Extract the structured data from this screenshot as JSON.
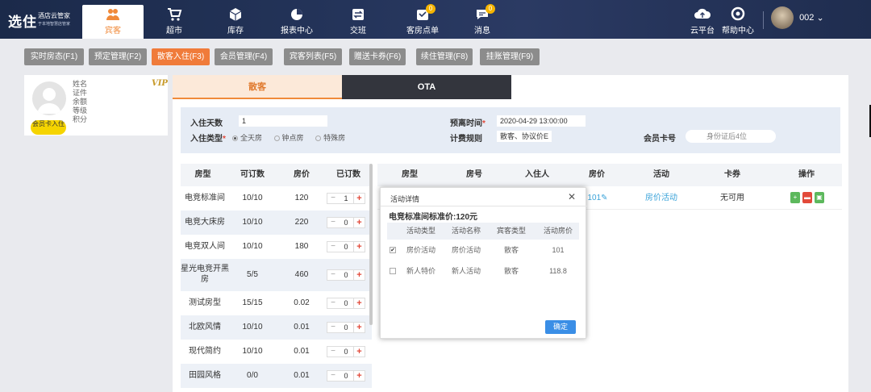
{
  "brand": {
    "logo": "选住",
    "sub1": "酒店云管家",
    "sub2": "于本地智慧店管家"
  },
  "nav": [
    {
      "label": "宾客",
      "icon": "guest-icon"
    },
    {
      "label": "超市",
      "icon": "cart-icon"
    },
    {
      "label": "库存",
      "icon": "box-icon"
    },
    {
      "label": "报表中心",
      "icon": "pie-chart-icon"
    },
    {
      "label": "交班",
      "icon": "swap-icon"
    },
    {
      "label": "客房点单",
      "icon": "order-icon",
      "badge": "0"
    },
    {
      "label": "消息",
      "icon": "message-icon",
      "badge": "0"
    }
  ],
  "right_nav": [
    {
      "label": "云平台",
      "icon": "cloud-icon"
    },
    {
      "label": "帮助中心",
      "icon": "help-icon"
    }
  ],
  "user": {
    "name": "002"
  },
  "tabs": [
    "实时房态(F1)",
    "预定管理(F2)",
    "散客入住(F3)",
    "会员管理(F4)",
    "宾客列表(F5)",
    "赠送卡券(F6)",
    "续住管理(F8)",
    "挂账管理(F9)"
  ],
  "active_tab": "散客入住(F3)",
  "member": {
    "vip": "VIP",
    "fields": [
      "姓名",
      "证件",
      "余额",
      "等级",
      "积分"
    ],
    "badge": "会员卡入住"
  },
  "segments": [
    "散客",
    "OTA"
  ],
  "filter": {
    "days_label": "入住天数",
    "days_value": "1",
    "type_label": "入住类型",
    "types": [
      "全天房",
      "钟点房",
      "特殊房"
    ],
    "leave_label": "预离时间",
    "leave_value": "2020-04-29 13:00:00",
    "rule_label": "计费规则",
    "rule_value": "散客、协议价E",
    "card_label": "会员卡号",
    "card_placeholder": "身份证后4位"
  },
  "room_table": {
    "headers": [
      "房型",
      "可订数",
      "房价",
      "已订数"
    ],
    "rows": [
      {
        "name": "电竞标准间",
        "avail": "10/10",
        "price": "120",
        "booked": "1"
      },
      {
        "name": "电竞大床房",
        "avail": "10/10",
        "price": "220",
        "booked": "0"
      },
      {
        "name": "电竞双人间",
        "avail": "10/10",
        "price": "180",
        "booked": "0"
      },
      {
        "name": "星光电竞开黑房",
        "avail": "5/5",
        "price": "460",
        "booked": "0"
      },
      {
        "name": "测试房型",
        "avail": "15/15",
        "price": "0.02",
        "booked": "0"
      },
      {
        "name": "北欧风情",
        "avail": "10/10",
        "price": "0.01",
        "booked": "0"
      },
      {
        "name": "现代简约",
        "avail": "10/10",
        "price": "0.01",
        "booked": "0"
      },
      {
        "name": "田园风格",
        "avail": "0/0",
        "price": "0.01",
        "booked": "0"
      }
    ]
  },
  "order_table": {
    "headers": [
      "房型",
      "房号",
      "入住人",
      "房价",
      "活动",
      "卡券",
      "操作"
    ],
    "row": {
      "price": "101",
      "activity": "房价活动",
      "coupon": "无可用"
    }
  },
  "modal": {
    "title": "活动详情",
    "subtitle": "电竞标准间标准价:120元",
    "headers": [
      "活动类型",
      "活动名称",
      "宾客类型",
      "活动房价"
    ],
    "rows": [
      {
        "checked": true,
        "type": "房价活动",
        "name": "房价活动",
        "guest": "散客",
        "price": "101"
      },
      {
        "checked": false,
        "type": "新人特价",
        "name": "新人活动",
        "guest": "散客",
        "price": "118.8"
      }
    ],
    "ok": "确定"
  }
}
